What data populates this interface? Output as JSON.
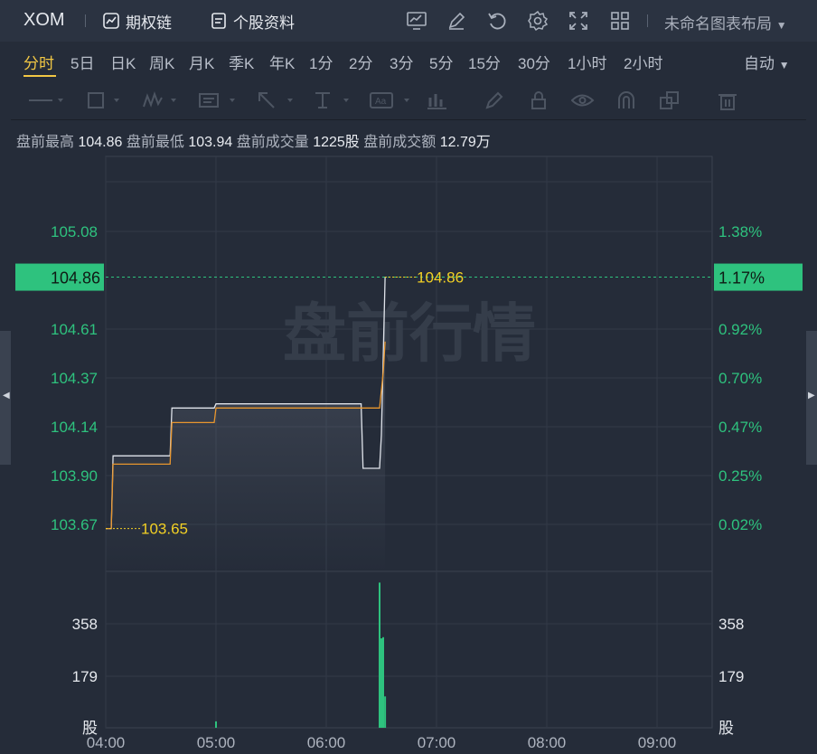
{
  "topbar": {
    "symbol": "XOM",
    "options_chain": "期权链",
    "stock_profile": "个股资料",
    "layout_name": "未命名图表布局",
    "icons": [
      "chart-icon",
      "edit-icon",
      "undo-icon",
      "settings-icon",
      "fullscreen-icon",
      "grid-layout-icon"
    ]
  },
  "periods": [
    {
      "label": "分时",
      "active": true
    },
    {
      "label": "5日"
    },
    {
      "label": "日K"
    },
    {
      "label": "周K"
    },
    {
      "label": "月K"
    },
    {
      "label": "季K"
    },
    {
      "label": "年K"
    },
    {
      "label": "1分"
    },
    {
      "label": "2分"
    },
    {
      "label": "3分"
    },
    {
      "label": "5分"
    },
    {
      "label": "15分"
    },
    {
      "label": "30分"
    },
    {
      "label": "1小时"
    },
    {
      "label": "2小时"
    }
  ],
  "auto_label": "自动",
  "draw_tools": [
    "line-tool-icon",
    "rectangle-tool-icon",
    "pattern-tool-icon",
    "text-note-tool-icon",
    "arrow-tool-icon",
    "measure-tool-icon",
    "label-tool-icon",
    "bar-tool-icon",
    "pencil-icon",
    "lock-icon",
    "eye-icon",
    "magnet-icon",
    "copy-icon",
    "trash-icon"
  ],
  "stats": {
    "high_label": "盘前最高",
    "high": "104.86",
    "low_label": "盘前最低",
    "low": "103.94",
    "volume_label": "盘前成交量",
    "volume": "1225股",
    "amount_label": "盘前成交额",
    "amount": "12.79万"
  },
  "watermark": "盘前行情",
  "chart_data": {
    "type": "line",
    "price_axis_ticks": [
      "105.08",
      "104.61",
      "104.37",
      "104.14",
      "103.90",
      "103.67"
    ],
    "price_axis_values": [
      105.08,
      104.61,
      104.37,
      104.14,
      103.9,
      103.67
    ],
    "percent_axis_ticks": [
      "1.38%",
      "0.92%",
      "0.70%",
      "0.47%",
      "0.25%",
      "0.02%"
    ],
    "current_price": "104.86",
    "current_percent": "1.17%",
    "high_marker": "104.86",
    "low_marker": "103.65",
    "volume_ticks": [
      "358",
      "179",
      "股"
    ],
    "volume_tick_values": [
      358,
      179,
      0
    ],
    "time_ticks": [
      "04:00",
      "05:00",
      "06:00",
      "07:00",
      "08:00",
      "09:00"
    ],
    "x_range": [
      "04:00",
      "09:30"
    ],
    "series": [
      {
        "x": [
          "04:00",
          "04:03",
          "04:04",
          "04:35",
          "04:36",
          "04:59",
          "05:00",
          "06:19",
          "06:20",
          "06:29",
          "06:30",
          "06:32"
        ],
        "values": [
          103.65,
          103.65,
          104.0,
          104.0,
          104.23,
          104.23,
          104.25,
          104.25,
          103.94,
          103.94,
          104.1,
          104.86
        ]
      },
      {
        "x": [
          "04:00",
          "04:03",
          "04:04",
          "04:35",
          "04:36",
          "04:59",
          "05:00",
          "06:19",
          "06:21",
          "06:29",
          "06:31",
          "06:32"
        ],
        "values": [
          103.65,
          103.65,
          103.96,
          103.96,
          104.16,
          104.16,
          104.23,
          104.23,
          104.23,
          104.23,
          104.4,
          104.55
        ]
      }
    ],
    "volume": {
      "x": [
        "05:00",
        "06:29",
        "06:30",
        "06:31",
        "06:32"
      ],
      "values": [
        22,
        500,
        308,
        312,
        108
      ]
    }
  }
}
